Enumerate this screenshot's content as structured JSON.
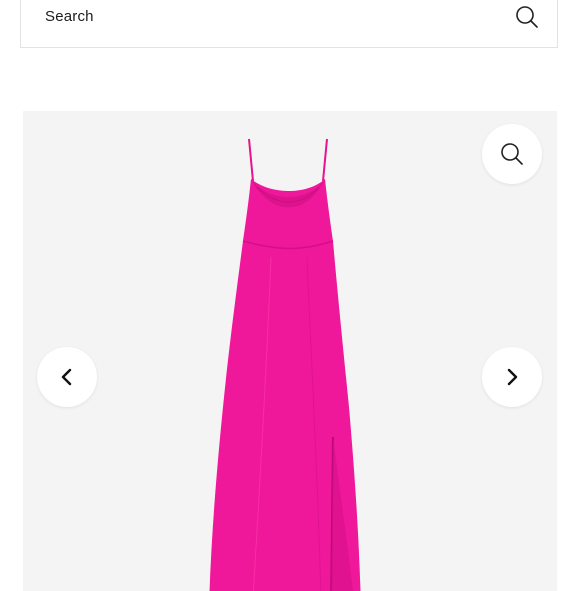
{
  "search": {
    "label": "Search",
    "icon": "search-icon"
  },
  "gallery": {
    "product_image": "pink-cowl-neck-slip-dress",
    "dress_color": "#f0189a",
    "background": "#f4f4f4",
    "controls": {
      "zoom_icon": "zoom-icon",
      "prev_icon": "chevron-left-icon",
      "next_icon": "chevron-right-icon"
    }
  }
}
